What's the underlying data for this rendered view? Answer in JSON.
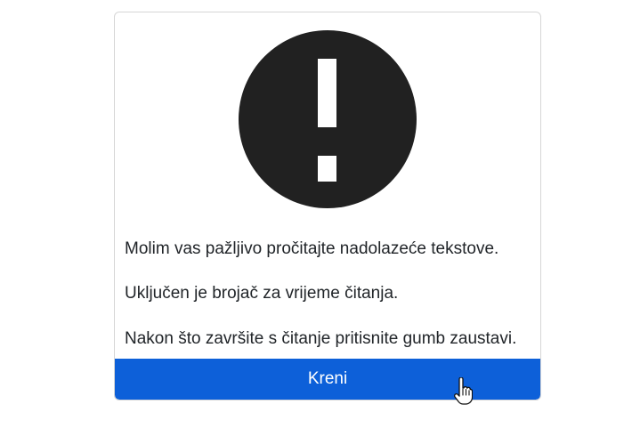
{
  "dialog": {
    "icon": "exclamation-circle-icon",
    "messages": [
      "Molim vas pažljivo pročitajte nadolazeće tekstove.",
      "Uključen je brojač za vrijeme čitanja.",
      "Nakon što završite s čitanje pritisnite gumb zaustavi."
    ],
    "start_button_label": "Kreni"
  },
  "colors": {
    "icon": "#212121",
    "button_background": "#0d60d9",
    "button_text": "#ffffff",
    "text": "#212529",
    "card_border": "#d6d6d6"
  },
  "cursor": {
    "icon": "hand-pointer-icon"
  }
}
